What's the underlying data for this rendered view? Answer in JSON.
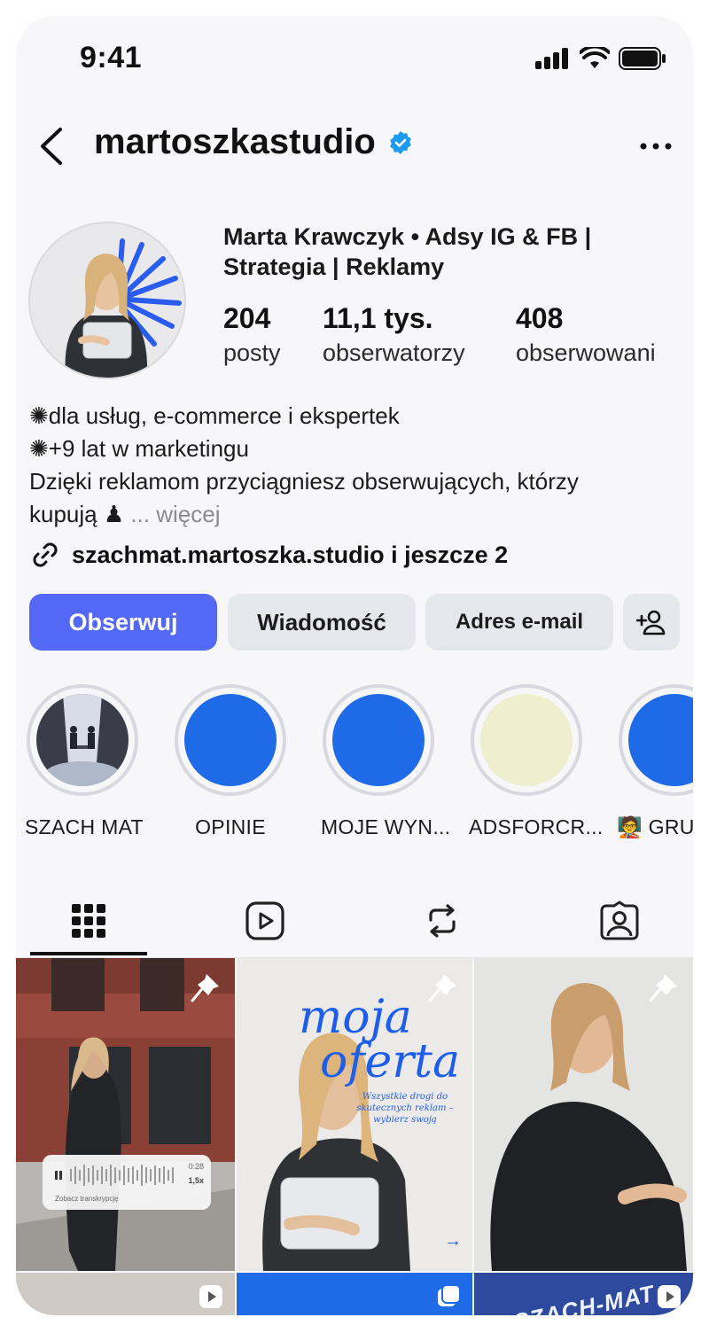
{
  "status": {
    "time": "9:41"
  },
  "header": {
    "username": "martoszkastudio"
  },
  "profile": {
    "full_name": "Marta Krawczyk • Adsy IG & FB | Strategia | Reklamy",
    "stats": [
      {
        "value": "204",
        "label": "posty"
      },
      {
        "value": "11,1 tys.",
        "label": "obserwatorzy"
      },
      {
        "value": "408",
        "label": "obserwowani"
      }
    ],
    "bio": {
      "line1": "✺dla usług, e-commerce i ekspertek",
      "line2": "✺+9 lat w marketingu",
      "line3": "Dzięki reklamom przyciągniesz obserwujących, którzy",
      "line4": "kupują ♟",
      "more": "... więcej"
    },
    "link": "szachmat.martoszka.studio i jeszcze 2"
  },
  "actions": {
    "follow": "Obserwuj",
    "message": "Wiadomość",
    "email": "Adres e-mail"
  },
  "highlights": [
    {
      "label": "SZACH MAT",
      "color": "#3a3d48"
    },
    {
      "label": "OPINIE",
      "color": "#1f6ae6"
    },
    {
      "label": "MOJE WYN...",
      "color": "#1f6ae6"
    },
    {
      "label": "ADSFORCR...",
      "color": "#efefcf"
    },
    {
      "label": "🧑‍🏫 GRU",
      "color": "#1f6ae6"
    }
  ],
  "tabs": [
    "grid-icon",
    "reels-icon",
    "reposts-icon",
    "tagged-icon"
  ],
  "posts": {
    "audio_time": "0:28",
    "audio_speed": "1,5x",
    "audio_transcript": "Zobacz transkrypcję",
    "oferta_title_1": "moja",
    "oferta_title_2": "oferta",
    "oferta_subtitle": "Wszystkie drogi do skutecznych reklam – wybierz swoją",
    "oferta_arrow": "→",
    "szach_text": "SZACH-MAT PRZEGÓ"
  },
  "colors": {
    "accent": "#5468f6",
    "verified": "#1d9bf0",
    "highlight_blue": "#1f6ae6"
  }
}
